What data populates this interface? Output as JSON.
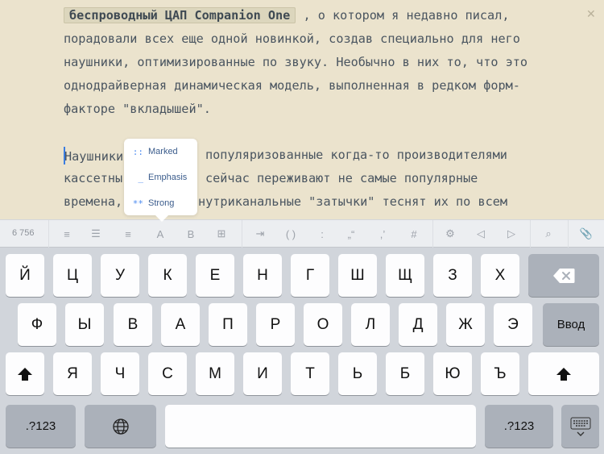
{
  "editor": {
    "close_label": "✕",
    "line1_chip": "беспроводный ЦАП Companion One",
    "line1_rest": " , о котором я недавно писал,",
    "line2": "порадовали всех еще одной новинкой, создав специально для него",
    "line3": "наушники, оптимизированные по звуку. Необычно в них то, что это",
    "line4": "однодрайверная динамическая модель, выполненная в редком форм-",
    "line5": "факторе \"вкладышей\".",
    "line6_start": "Наушники",
    "line6_end": "популяризованные когда-то производителями",
    "line7_start": "кассетны",
    "line7_end": "сейчас переживают не самые популярные",
    "line8_start": "времена,",
    "line8_end": "нутриканальные \"затычки\" теснят их по всем"
  },
  "popup": {
    "items": [
      {
        "marker": "::",
        "label": "Marked"
      },
      {
        "marker": "_",
        "label": "Emphasis"
      },
      {
        "marker": "**",
        "label": "Strong"
      }
    ]
  },
  "toolbar": {
    "word_count": "6 756",
    "buttons": [
      "≡",
      "☰",
      "≡",
      "A",
      "B",
      "⊞",
      "⇥",
      "( )",
      ":",
      "„“",
      ",’",
      "#",
      "⚙",
      "◁",
      "▷",
      "⌕",
      "📎"
    ],
    "icons": [
      "align-left-icon",
      "list-icon",
      "align-right-icon",
      "italic-icon",
      "bold-icon",
      "grid-icon",
      "tab-icon",
      "parentheses-icon",
      "colon-icon",
      "quotes-icon",
      "apostrophe-icon",
      "hash-icon",
      "settings-icon",
      "arrow-left-icon",
      "arrow-right-icon",
      "search-icon",
      "paperclip-icon"
    ]
  },
  "keyboard": {
    "row1": [
      "Й",
      "Ц",
      "У",
      "К",
      "Е",
      "Н",
      "Г",
      "Ш",
      "Щ",
      "З",
      "Х"
    ],
    "row2": [
      "Ф",
      "Ы",
      "В",
      "А",
      "П",
      "Р",
      "О",
      "Л",
      "Д",
      "Ж",
      "Э"
    ],
    "row3": [
      "Я",
      "Ч",
      "С",
      "М",
      "И",
      "Т",
      "Ь",
      "Б",
      "Ю",
      "Ъ"
    ],
    "enter_label": "Ввод",
    "numbers_label": ".?123",
    "icons": {
      "backspace": "backspace-icon",
      "shift": "shift-icon",
      "globe": "globe-icon",
      "hide": "keyboard-hide-icon"
    }
  }
}
